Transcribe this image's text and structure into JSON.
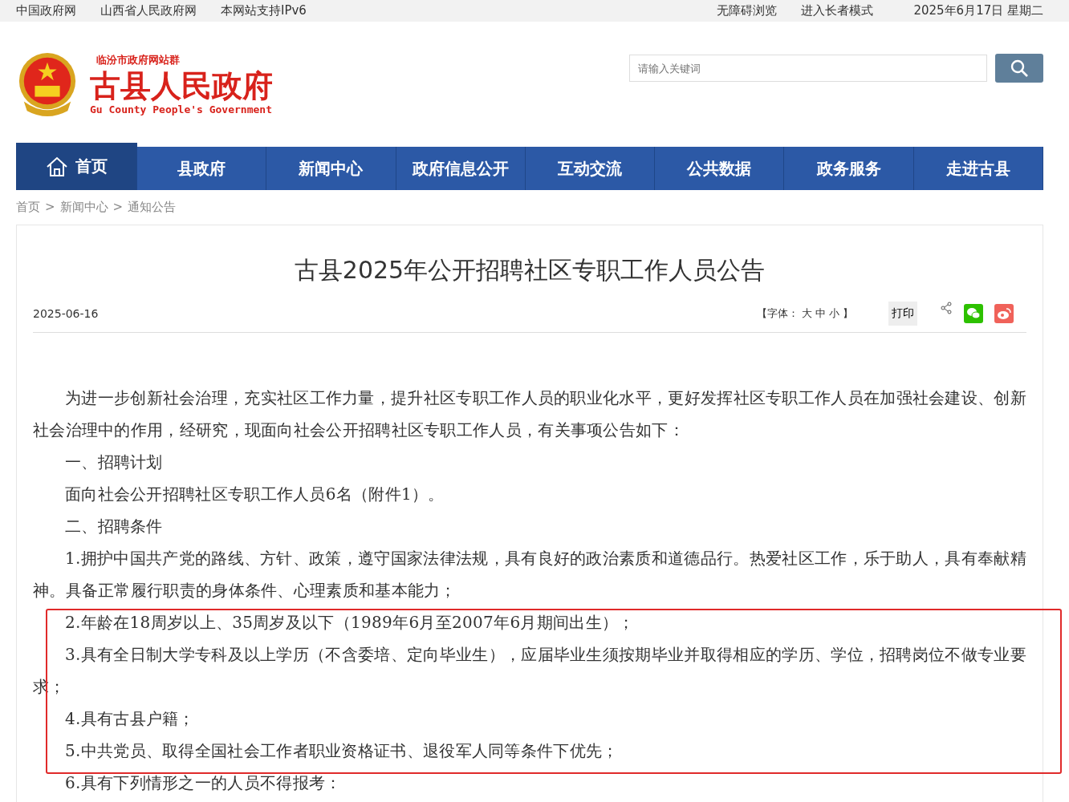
{
  "top_bar": {
    "left_links": [
      "中国政府网",
      "山西省人民政府网",
      "本网站支持IPv6"
    ],
    "right_links": [
      "无障碍浏览",
      "进入长者模式"
    ],
    "date": "2025年6月17日 星期二"
  },
  "header": {
    "site_group": "临汾市政府网站群",
    "site_name": "古县人民政府",
    "site_name_en": "Gu County People's Government",
    "search": {
      "placeholder": "请输入关键词"
    }
  },
  "nav": [
    {
      "label": "首页",
      "selected": true
    },
    {
      "label": "县政府",
      "selected": false
    },
    {
      "label": "新闻中心",
      "selected": false
    },
    {
      "label": "政府信息公开",
      "selected": false
    },
    {
      "label": "互动交流",
      "selected": false
    },
    {
      "label": "公共数据",
      "selected": false
    },
    {
      "label": "政务服务",
      "selected": false
    },
    {
      "label": "走进古县",
      "selected": false
    }
  ],
  "breadcrumb": {
    "separator": ">",
    "items": [
      "首页",
      "新闻中心",
      "通知公告"
    ]
  },
  "article": {
    "title": "古县2025年公开招聘社区专职工作人员公告",
    "date": "2025-06-16",
    "font_size_label": "【字体：",
    "font_sizes": [
      "大",
      "中",
      "小"
    ],
    "font_size_end": "】",
    "print": "打印",
    "paragraphs": [
      "为进一步创新社会治理，充实社区工作力量，提升社区专职工作人员的职业化水平，更好发挥社区专职工作人员在加强社会建设、创新社会治理中的作用，经研究，现面向社会公开招聘社区专职工作人员，有关事项公告如下：",
      "一、招聘计划",
      "面向社会公开招聘社区专职工作人员6名（附件1）。",
      "二、招聘条件",
      "1.拥护中国共产党的路线、方针、政策，遵守国家法律法规，具有良好的政治素质和道德品行。热爱社区工作，乐于助人，具有奉献精神。具备正常履行职责的身体条件、心理素质和基本能力；",
      "2.年龄在18周岁以上、35周岁及以下（1989年6月至2007年6月期间出生）；",
      "3.具有全日制大学专科及以上学历（不含委培、定向毕业生），应届毕业生须按期毕业并取得相应的学历、学位，招聘岗位不做专业要求；",
      "4.具有古县户籍；",
      "5.中共党员、取得全国社会工作者职业资格证书、退役军人同等条件下优先；",
      "6.具有下列情形之一的人员不得报考："
    ]
  }
}
